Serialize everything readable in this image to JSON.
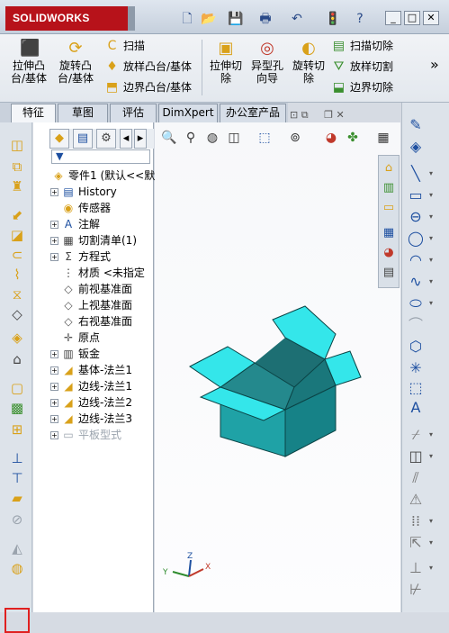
{
  "app": {
    "logo": "SOLIDWORKS"
  },
  "titlebar": {
    "icons": [
      "new-document-icon",
      "open-folder-icon",
      "save-icon",
      "print-icon",
      "undo-icon",
      "traffic-light-icon",
      "help-icon"
    ],
    "window_buttons": [
      "_",
      "□",
      "✕"
    ]
  },
  "ribbon": {
    "big": [
      {
        "label": "拉伸凸\n台/基体",
        "icon": "extrude-boss-icon"
      },
      {
        "label": "旋转凸\n台/基体",
        "icon": "revolve-boss-icon"
      },
      {
        "label": "拉伸切\n除",
        "icon": "extrude-cut-icon"
      },
      {
        "label": "异型孔\n向导",
        "icon": "hole-wizard-icon"
      },
      {
        "label": "旋转切\n除",
        "icon": "revolve-cut-icon"
      }
    ],
    "small_left": [
      {
        "label": "扫描",
        "icon": "sweep-icon"
      },
      {
        "label": "放样凸台/基体",
        "icon": "loft-icon"
      },
      {
        "label": "边界凸台/基体",
        "icon": "boundary-boss-icon"
      }
    ],
    "small_right": [
      {
        "label": "扫描切除",
        "icon": "swept-cut-icon"
      },
      {
        "label": "放样切割",
        "icon": "lofted-cut-icon"
      },
      {
        "label": "边界切除",
        "icon": "boundary-cut-icon"
      }
    ],
    "more": "»"
  },
  "tabs": [
    {
      "label": "特征",
      "active": true
    },
    {
      "label": "草图",
      "active": false
    },
    {
      "label": "评估",
      "active": false
    },
    {
      "label": "DimXpert",
      "active": false
    },
    {
      "label": "办公室产品",
      "active": false
    }
  ],
  "feature_manager": {
    "filter_icon": "filter-icon",
    "root": "零件1 (默认<<默",
    "items": [
      {
        "label": "History",
        "icon": "history-icon",
        "expandable": true
      },
      {
        "label": "传感器",
        "icon": "sensor-icon",
        "expandable": false
      },
      {
        "label": "注解",
        "icon": "annotation-icon",
        "expandable": true
      },
      {
        "label": "切割清单(1)",
        "icon": "cut-list-icon",
        "expandable": true
      },
      {
        "label": "方程式",
        "icon": "equation-icon",
        "expandable": true
      },
      {
        "label": "材质 <未指定",
        "icon": "material-icon",
        "expandable": false
      },
      {
        "label": "前视基准面",
        "icon": "plane-icon",
        "expandable": false
      },
      {
        "label": "上视基准面",
        "icon": "plane-icon",
        "expandable": false
      },
      {
        "label": "右视基准面",
        "icon": "plane-icon",
        "expandable": false
      },
      {
        "label": "原点",
        "icon": "origin-icon",
        "expandable": false
      },
      {
        "label": "钣金",
        "icon": "sheet-metal-icon",
        "expandable": true
      },
      {
        "label": "基体-法兰1",
        "icon": "base-flange-icon",
        "expandable": true
      },
      {
        "label": "边线-法兰1",
        "icon": "edge-flange-icon",
        "expandable": true
      },
      {
        "label": "边线-法兰2",
        "icon": "edge-flange-icon",
        "expandable": true
      },
      {
        "label": "边线-法兰3",
        "icon": "edge-flange-icon",
        "expandable": true
      },
      {
        "label": "平板型式",
        "icon": "flat-pattern-icon",
        "expandable": true,
        "greyed": true
      }
    ]
  },
  "triad": {
    "x": "X",
    "y": "Y",
    "z": "Z"
  },
  "colors": {
    "accent_red": "#e02020",
    "box_top": "#34e6ea",
    "box_side": "#1fa2a6",
    "box_inner": "#1d6f73",
    "logo_bg": "#b7121a"
  }
}
